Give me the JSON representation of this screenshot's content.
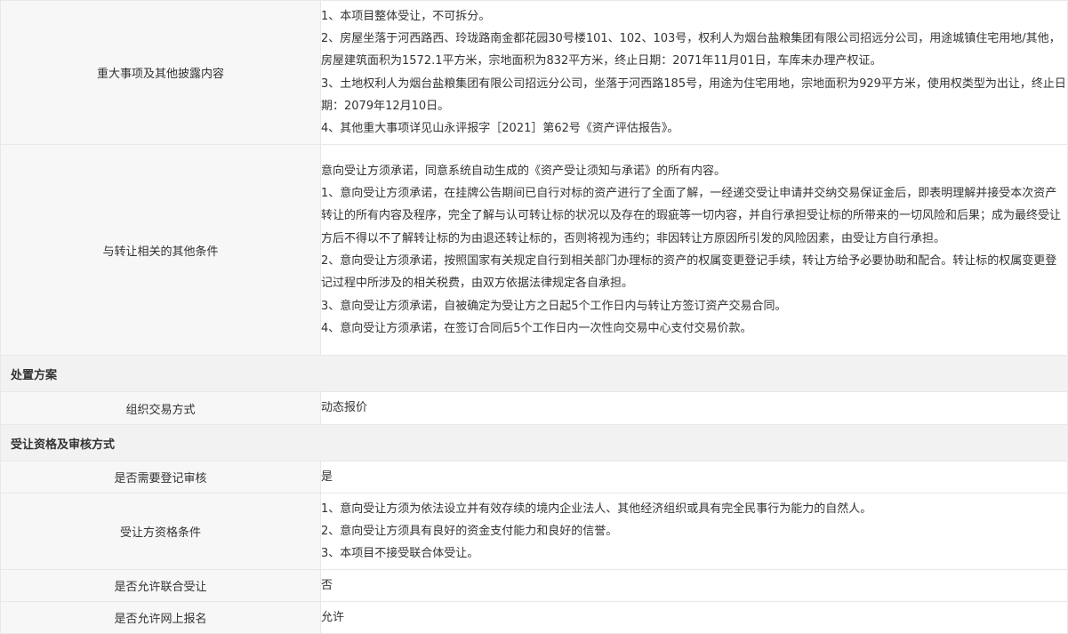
{
  "rows": {
    "major": {
      "label": "重大事项及其他披露内容",
      "lines": [
        "1、本项目整体受让，不可拆分。",
        "2、房屋坐落于河西路西、玲珑路南金都花园30号楼101、102、103号，权利人为烟台盐粮集团有限公司招远分公司，用途城镇住宅用地/其他，房屋建筑面积为1572.1平方米，宗地面积为832平方米，终止日期：2071年11月01日，车库未办理产权证。",
        "3、土地权利人为烟台盐粮集团有限公司招远分公司，坐落于河西路185号，用途为住宅用地，宗地面积为929平方米，使用权类型为出让，终止日期：2079年12月10日。",
        "4、其他重大事项详见山永评报字［2021］第62号《资产评估报告》。"
      ]
    },
    "other": {
      "label": "与转让相关的其他条件",
      "lines": [
        "意向受让方须承诺，同意系统自动生成的《资产受让须知与承诺》的所有内容。",
        "1、意向受让方须承诺，在挂牌公告期间已自行对标的资产进行了全面了解，一经递交受让申请并交纳交易保证金后，即表明理解并接受本次资产转让的所有内容及程序，完全了解与认可转让标的状况以及存在的瑕疵等一切内容，并自行承担受让标的所带来的一切风险和后果；成为最终受让方后不得以不了解转让标的为由退还转让标的，否则将视为违约；非因转让方原因所引发的风险因素，由受让方自行承担。",
        "2、意向受让方须承诺，按照国家有关规定自行到相关部门办理标的资产的权属变更登记手续，转让方给予必要协助和配合。转让标的权属变更登记过程中所涉及的相关税费，由双方依据法律规定各自承担。",
        "3、意向受让方须承诺，自被确定为受让方之日起5个工作日内与转让方签订资产交易合同。",
        "4、意向受让方须承诺，在签订合同后5个工作日内一次性向交易中心支付交易价款。"
      ]
    },
    "section_disposal": "处置方案",
    "method": {
      "label": "组织交易方式",
      "value": "动态报价"
    },
    "section_qualification": "受让资格及审核方式",
    "register_review": {
      "label": "是否需要登记审核",
      "value": "是"
    },
    "qualification": {
      "label": "受让方资格条件",
      "lines": [
        "1、意向受让方须为依法设立并有效存续的境内企业法人、其他经济组织或具有完全民事行为能力的自然人。",
        "2、意向受让方须具有良好的资金支付能力和良好的信誉。",
        "3、本项目不接受联合体受让。"
      ]
    },
    "joint": {
      "label": "是否允许联合受让",
      "value": "否"
    },
    "online": {
      "label": "是否允许网上报名",
      "value": "允许"
    }
  }
}
